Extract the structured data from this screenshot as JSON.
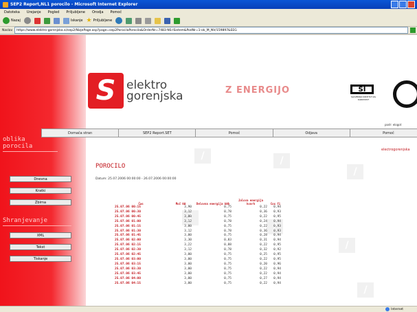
{
  "window": {
    "title": "SEP2 Report,NL1 porocilo - Microsoft Internet Explorer"
  },
  "menu": [
    "Datoteka",
    "Urejanje",
    "Pogled",
    "Priljubljene",
    "Orodja",
    "Pomoč"
  ],
  "toolbar": {
    "back": "Nazaj",
    "search": "Iskanje",
    "favorites": "Priljubljene"
  },
  "address": {
    "label": "Naslov",
    "url": "https://www.elektro-gorenjska.si/sep2/NizjePage.asp?page=sep2PorocilaPorocila&OrderNr=7483-NS-ISistem&PodNr=1-ok_M_NV/159897&EEG"
  },
  "nav": [
    "Domača stran",
    "SEP2 Report.SET",
    "Pomoč",
    "Odjava",
    "Pomoč"
  ],
  "logo": {
    "line1": "elektro",
    "line2": "gorenjska",
    "slogan": "Z ENERGIJO"
  },
  "si": {
    "text": "SI",
    "caption": "SLOVENSKI INSTITUT ZA KAKOVOST"
  },
  "user": {
    "label": "podr:",
    "value": "elogot"
  },
  "sidebar": {
    "section1": [
      "oblika",
      "porocila"
    ],
    "section1_buttons": [
      "Dnevna",
      "Kratki",
      "Zbirna"
    ],
    "section2": "Shranjevanje",
    "section2_buttons": [
      "XML",
      "Tekst",
      "Tiskanje"
    ]
  },
  "report": {
    "title": "POROCILO",
    "date_range": "Datum: 25.07.2006 00:00:00 - 26.07.2006 00:00:00",
    "link": "electrogorenjska"
  },
  "table": {
    "headers": [
      "Čas",
      "Moč kW",
      "Delovna energija kWh",
      "Jalova energija kvarh",
      "Cos fi"
    ],
    "rows": [
      [
        "25.07.06 00:15",
        "3,90",
        "0,75",
        "0,22",
        "0,94"
      ],
      [
        "25.07.06 00:30",
        "3,12",
        "0,78",
        "0,36",
        "0,93"
      ],
      [
        "25.07.06 00:45",
        "3,00",
        "0,75",
        "0,22",
        "0,95"
      ],
      [
        "25.07.06 01:00",
        "3,12",
        "0,78",
        "0,24",
        "0,94"
      ],
      [
        "25.07.06 01:15",
        "3,00",
        "0,75",
        "0,22",
        "0,93"
      ],
      [
        "25.07.06 01:30",
        "3,12",
        "0,78",
        "0,36",
        "0,93"
      ],
      [
        "25.07.06 01:45",
        "3,00",
        "0,75",
        "0,28",
        "0,94"
      ],
      [
        "25.07.06 02:00",
        "3,30",
        "0,83",
        "0,31",
        "0,94"
      ],
      [
        "25.07.06 02:15",
        "3,22",
        "0,88",
        "0,22",
        "0,95"
      ],
      [
        "25.07.06 02:30",
        "3,12",
        "0,78",
        "0,32",
        "0,92"
      ],
      [
        "25.07.06 02:45",
        "3,00",
        "0,75",
        "0,25",
        "0,95"
      ],
      [
        "25.07.06 03:00",
        "3,00",
        "0,75",
        "0,22",
        "0,95"
      ],
      [
        "25.07.06 03:15",
        "3,00",
        "0,75",
        "0,20",
        "0,96"
      ],
      [
        "25.07.06 03:30",
        "3,00",
        "0,75",
        "0,22",
        "0,94"
      ],
      [
        "25.07.06 03:45",
        "3,00",
        "0,75",
        "0,22",
        "0,94"
      ],
      [
        "25.07.06 04:00",
        "3,00",
        "0,75",
        "0,27",
        "0,94"
      ],
      [
        "25.07.06 04:15",
        "3,00",
        "0,75",
        "0,22",
        "0,94"
      ]
    ]
  },
  "status": {
    "internet": "Internet"
  }
}
